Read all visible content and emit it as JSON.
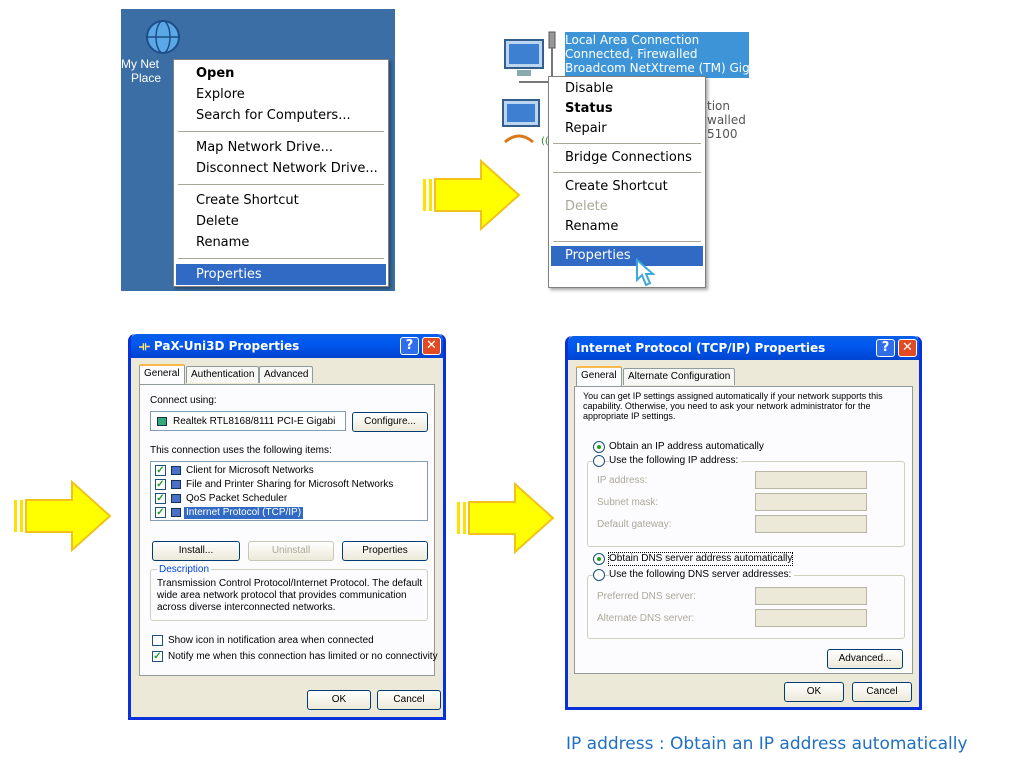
{
  "desktop": {
    "icon_label_lines": [
      "My Net",
      "Place"
    ],
    "menu": [
      {
        "label": "Open",
        "bold": true
      },
      {
        "label": "Explore"
      },
      {
        "label": "Search for Computers..."
      },
      {
        "sep": true
      },
      {
        "label": "Map Network Drive..."
      },
      {
        "label": "Disconnect Network Drive..."
      },
      {
        "sep": true
      },
      {
        "label": "Create Shortcut"
      },
      {
        "label": "Delete"
      },
      {
        "label": "Rename"
      },
      {
        "sep": true
      },
      {
        "label": "Properties",
        "highlighted": true
      }
    ]
  },
  "connections": {
    "selected": {
      "name": "Local Area Connection",
      "status": "Connected, Firewalled",
      "device": "Broadcom NetXtreme (TM) Gigabit..."
    },
    "second_fragments": [
      "tion",
      "walled",
      "5100"
    ],
    "menu": [
      {
        "label": "Disable"
      },
      {
        "label": "Status",
        "bold": true
      },
      {
        "label": "Repair"
      },
      {
        "sep": true
      },
      {
        "label": "Bridge Connections"
      },
      {
        "sep": true
      },
      {
        "label": "Create Shortcut"
      },
      {
        "label": "Delete",
        "disabled": true
      },
      {
        "label": "Rename"
      },
      {
        "sep": true
      },
      {
        "label": "Properties",
        "highlighted": true
      }
    ]
  },
  "dialog1": {
    "title": "PaX-Uni3D Properties",
    "tabs": [
      "General",
      "Authentication",
      "Advanced"
    ],
    "connect_using_label": "Connect using:",
    "adapter": "Realtek RTL8168/8111 PCI-E Gigabi",
    "configure_btn": "Configure...",
    "items_label": "This connection uses the following items:",
    "items": [
      {
        "label": "Client for Microsoft Networks",
        "checked": true,
        "selected": false
      },
      {
        "label": "File and Printer Sharing for Microsoft Networks",
        "checked": true,
        "selected": false
      },
      {
        "label": "QoS Packet Scheduler",
        "checked": true,
        "selected": false
      },
      {
        "label": "Internet Protocol (TCP/IP)",
        "checked": true,
        "selected": true
      }
    ],
    "install_btn": "Install...",
    "uninstall_btn": "Uninstall",
    "properties_btn": "Properties",
    "description_label": "Description",
    "description": [
      "Transmission Control Protocol/Internet Protocol. The default",
      "wide area network protocol that provides communication",
      "across diverse interconnected networks."
    ],
    "show_icon": "Show icon in notification area when connected",
    "show_icon_checked": false,
    "notify": "Notify me when this connection has limited or no connectivity",
    "notify_checked": true,
    "ok": "OK",
    "cancel": "Cancel"
  },
  "dialog2": {
    "title": "Internet Protocol (TCP/IP) Properties",
    "tabs": [
      "General",
      "Alternate Configuration"
    ],
    "intro": [
      "You can get IP settings assigned automatically if your network supports this",
      "capability. Otherwise, you need to ask your network administrator for the",
      "appropriate IP settings."
    ],
    "obtain_ip": "Obtain an IP address automatically",
    "use_ip": "Use the following IP address:",
    "ip_fields": [
      "IP address:",
      "Subnet mask:",
      "Default gateway:"
    ],
    "obtain_dns": "Obtain DNS server address automatically",
    "use_dns": "Use the following DNS server addresses:",
    "dns_fields": [
      "Preferred DNS server:",
      "Alternate DNS server:"
    ],
    "advanced_btn": "Advanced...",
    "ok": "OK",
    "cancel": "Cancel",
    "ip_mode": "automatic",
    "dns_mode": "automatic"
  },
  "caption": "IP address : Obtain an IP address automatically",
  "colors": {
    "desktop": "#3a6ea5",
    "menu_highlight": "#316ac5",
    "selection_blue": "#3d95d8",
    "arrow_fill": "#ffff00",
    "caption": "#1f6fc4"
  }
}
